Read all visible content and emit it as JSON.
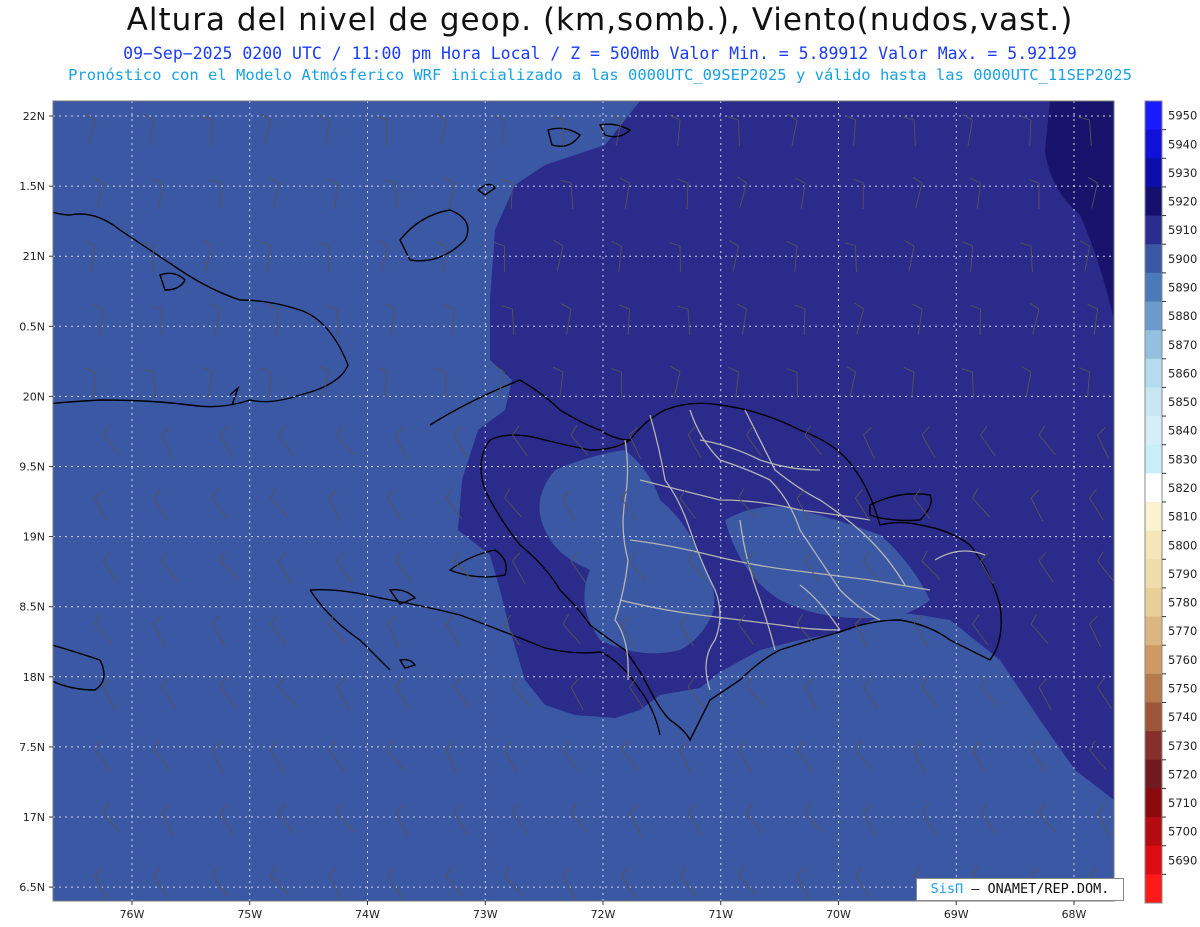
{
  "header": {
    "title": "Altura del nivel de geop. (km,somb.), Viento(nudos,vast.)",
    "subtitle_line1": "09−Sep−2025  0200 UTC / 11:00 pm Hora Local / Z = 500mb   Valor Min. = 5.89912  Valor Max. = 5.92129",
    "subtitle_line2": "Pronóstico con el Modelo Atmósferico WRF inicializado a las 0000UTC_09SEP2025 y válido hasta las  0000UTC_11SEP2025"
  },
  "map": {
    "lat_labels": [
      "22N",
      "1.5N",
      "21N",
      "0.5N",
      "20N",
      "9.5N",
      "19N",
      "8.5N",
      "18N",
      "7.5N",
      "17N",
      "6.5N"
    ],
    "lon_labels": [
      "76W",
      "75W",
      "74W",
      "73W",
      "72W",
      "71W",
      "70W",
      "69W",
      "68W"
    ],
    "shade_colors": {
      "5900_5910": "#3b58a5",
      "5910_5920": "#2b2b8b",
      "5920_5930": "#18146b",
      "land_outline": "#000000",
      "province_lines": "#b4b4b4"
    }
  },
  "colorbar": {
    "levels": [
      "5950",
      "5940",
      "5930",
      "5920",
      "5910",
      "5900",
      "5890",
      "5880",
      "5870",
      "5860",
      "5850",
      "5840",
      "5830",
      "5820",
      "5810",
      "5800",
      "5790",
      "5780",
      "5770",
      "5760",
      "5750",
      "5740",
      "5730",
      "5720",
      "5710",
      "5700",
      "5690"
    ],
    "colors": [
      "#1a1aff",
      "#1010d8",
      "#0d0daa",
      "#140f6d",
      "#2c2c8e",
      "#3a57a4",
      "#4a7ab8",
      "#6a9bcc",
      "#92c0de",
      "#b4dcee",
      "#c8e6f4",
      "#d6eef8",
      "#c9eef7",
      "#ffffff",
      "#fbf2cf",
      "#f4e6b9",
      "#efdcaa",
      "#e8cf98",
      "#dcb681",
      "#cc9a62",
      "#b67a4c",
      "#9e5638",
      "#86302c",
      "#6e1a20",
      "#8a0a0e",
      "#b50a10",
      "#dd0c12",
      "#ff1a1a"
    ]
  },
  "credit": {
    "brand": "SisΠ",
    "text": "– ONAMET/REP.DOM."
  }
}
